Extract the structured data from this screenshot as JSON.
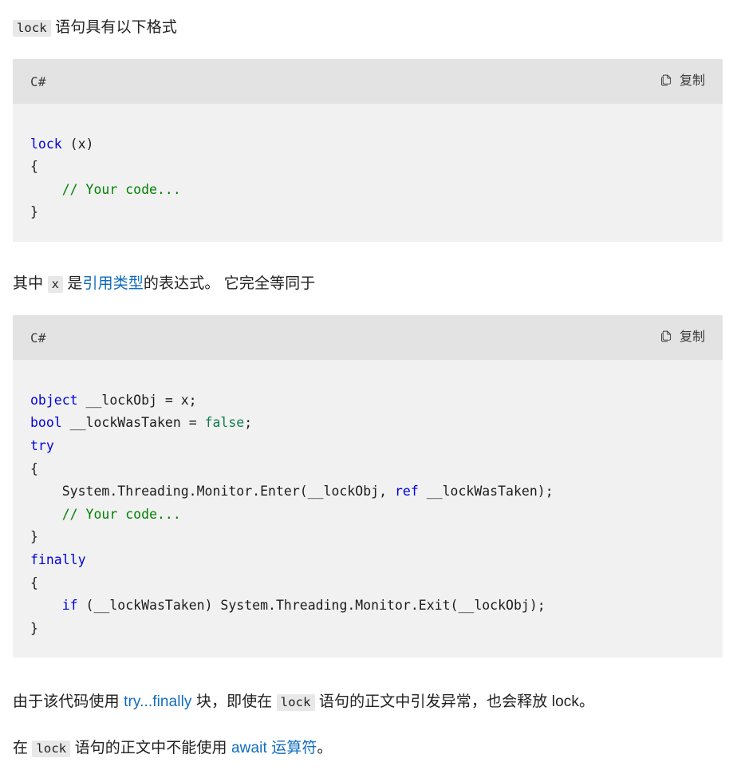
{
  "document": {
    "intro_paragraph": {
      "code_chip": "lock",
      "text_after": " 语句具有以下格式"
    },
    "middle_paragraph": {
      "text_before": "其中 ",
      "code_chip": "x",
      "text_mid": " 是",
      "link_text": "引用类型",
      "text_after": "的表达式。 它完全等同于"
    },
    "closing_paragraph_1": {
      "text_before": "由于该代码使用 ",
      "link_text": "try...finally",
      "text_mid": " 块，即使在 ",
      "code_chip": "lock",
      "text_after": " 语句的正文中引发异常，也会释放 lock。"
    },
    "closing_paragraph_2": {
      "text_before": "在 ",
      "code_chip": "lock",
      "text_mid": " 语句的正文中不能使用 ",
      "link_text": "await 运算符",
      "text_after": "。"
    }
  },
  "code_blocks": [
    {
      "language_label": "C#",
      "copy_label": "复制",
      "copy_icon": "copy-icon",
      "lines": [
        [
          {
            "t": "lock",
            "c": "k"
          },
          {
            "t": " (x)",
            "c": "pln"
          }
        ],
        [
          {
            "t": "{",
            "c": "pln"
          }
        ],
        [
          {
            "t": "    ",
            "c": "pln"
          },
          {
            "t": "// Your code...",
            "c": "cmt"
          }
        ],
        [
          {
            "t": "}",
            "c": "pln"
          }
        ]
      ]
    },
    {
      "language_label": "C#",
      "copy_label": "复制",
      "copy_icon": "copy-icon",
      "lines": [
        [
          {
            "t": "object",
            "c": "k"
          },
          {
            "t": " __lockObj = x;",
            "c": "pln"
          }
        ],
        [
          {
            "t": "bool",
            "c": "k"
          },
          {
            "t": " __lockWasTaken = ",
            "c": "pln"
          },
          {
            "t": "false",
            "c": "lit"
          },
          {
            "t": ";",
            "c": "pln"
          }
        ],
        [
          {
            "t": "try",
            "c": "k"
          }
        ],
        [
          {
            "t": "{",
            "c": "pln"
          }
        ],
        [
          {
            "t": "    System.Threading.Monitor.Enter(__lockObj, ",
            "c": "pln"
          },
          {
            "t": "ref",
            "c": "k"
          },
          {
            "t": " __lockWasTaken);",
            "c": "pln"
          }
        ],
        [
          {
            "t": "    ",
            "c": "pln"
          },
          {
            "t": "// Your code...",
            "c": "cmt"
          }
        ],
        [
          {
            "t": "}",
            "c": "pln"
          }
        ],
        [
          {
            "t": "finally",
            "c": "k"
          }
        ],
        [
          {
            "t": "{",
            "c": "pln"
          }
        ],
        [
          {
            "t": "    ",
            "c": "pln"
          },
          {
            "t": "if",
            "c": "k"
          },
          {
            "t": " (__lockWasTaken) System.Threading.Monitor.Exit(__lockObj);",
            "c": "pln"
          }
        ],
        [
          {
            "t": "}",
            "c": "pln"
          }
        ]
      ]
    }
  ],
  "colors": {
    "keyword": "#0000e0",
    "literal": "#107c52",
    "comment": "#008000",
    "link": "#0f6cbd",
    "code_header_bg": "#e3e3e3",
    "code_body_bg": "#f1f1f1",
    "inline_code_bg": "#e8e8e8",
    "text": "#212121"
  }
}
